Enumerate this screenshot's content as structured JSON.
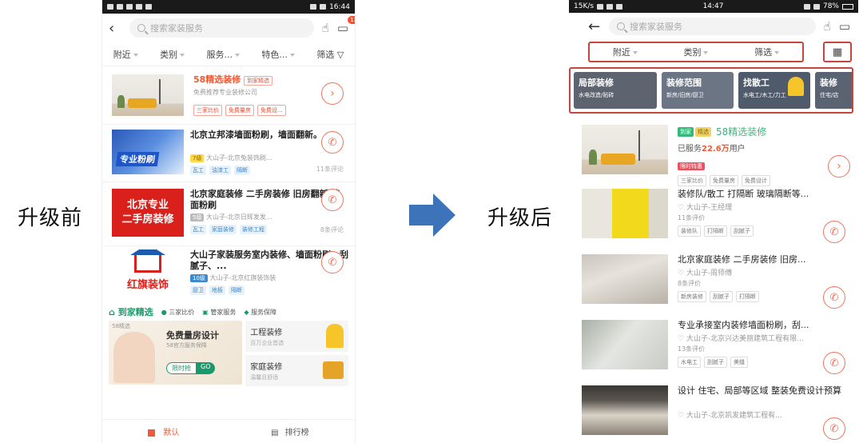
{
  "labels": {
    "before": "升级前",
    "after": "升级后"
  },
  "colors": {
    "accent": "#f0735a",
    "highlight_box": "#c3463f",
    "arrow": "#3c73b9"
  },
  "before": {
    "status": {
      "time": "16:44"
    },
    "search_placeholder": "搜索家装服务",
    "message_badge": "12",
    "filters": [
      "附近",
      "类别",
      "服务...",
      "特色...",
      "筛选"
    ],
    "featured": {
      "title": "58精选装修",
      "badge": "到家精选",
      "subtitle": "免费推荐专业装修公司",
      "tags": [
        "三家比价",
        "免费量房",
        "免费设..."
      ]
    },
    "listings": [
      {
        "title": "北京立邦漆墙面粉刷，墙面翻新。",
        "thumb_text": "专业粉刷",
        "level": "7级",
        "sub": "大山子-北京兔装饰刷...",
        "tags": [
          "瓦工",
          "油漆工",
          "隔断"
        ],
        "reviews": "11条评论"
      },
      {
        "title": "北京家庭装修 二手房装修 旧房翻新 墙面粉刷",
        "thumb_lines": [
          "北京专业",
          "二手房装修"
        ],
        "level": "5级",
        "sub": "大山子-北京日辉发发...",
        "tags": [
          "瓦工",
          "家庭装修",
          "装修工程"
        ],
        "reviews": "8条评论"
      },
      {
        "title": "大山子家装服务室内装修、墙面粉刷，刮腻子、...",
        "thumb_text": "红旗装饰",
        "level": "10级",
        "sub": "大山子-北京红旗装饰装",
        "tags": [
          "厨卫",
          "地板",
          "隔断"
        ],
        "reviews": ""
      }
    ],
    "daojia": {
      "title": "到家精选",
      "features": [
        "三家比价",
        "管家服务",
        "服务保障"
      ]
    },
    "promo": {
      "main_title": "免费量房设计",
      "main_sub": "58官方服务保障",
      "cta": "限时抢",
      "go": "GO",
      "corner": "58精选",
      "right": [
        {
          "title": "工程装修",
          "sub": "百万企业首选"
        },
        {
          "title": "家庭装修",
          "sub": "温馨且舒适"
        }
      ]
    },
    "bottom_tabs": [
      "默认",
      "排行榜"
    ]
  },
  "after": {
    "status": {
      "speed": "15K/s",
      "time": "14:47",
      "battery": "78%"
    },
    "search_placeholder": "搜索家装服务",
    "filters": [
      "附近",
      "类别",
      "筛选"
    ],
    "categories": [
      {
        "title": "局部装修",
        "sub": "水电改造/贴砖",
        "color": "#5d6470"
      },
      {
        "title": "装修范围",
        "sub": "新房/旧房/厨卫",
        "color": "#6c7584"
      },
      {
        "title": "找散工",
        "sub": "水电工/木工/力工",
        "color": "#4f5a6b"
      },
      {
        "title": "装修",
        "sub": "住宅/店",
        "color": "#5a6372"
      }
    ],
    "featured": {
      "badge1": "到家",
      "badge2": "精选",
      "title": "58精选装修",
      "served_prefix": "已服务",
      "served_count": "22.6万",
      "served_suffix": "用户",
      "promo": "限时特惠",
      "tags": [
        "三家比价",
        "免费量房",
        "免费设计"
      ]
    },
    "listings": [
      {
        "title": "装修队/散工 打隔断 玻璃隔断等...",
        "sub": "大山子-王经理",
        "reviews": "11条评价",
        "tags": [
          "装修队",
          "打隔断",
          "刮腻子"
        ]
      },
      {
        "title": "北京家庭装修 二手房装修 旧房...",
        "sub": "大山子-周师傅",
        "reviews": "8条评价",
        "tags": [
          "新房装修",
          "刮腻子",
          "打隔断"
        ]
      },
      {
        "title": "专业承接室内装修墙面粉刷，刮...",
        "sub": "大山子-北京兴达美丽建筑工程有限...",
        "reviews": "13条评价",
        "tags": [
          "水电工",
          "刮腻子",
          "美缝"
        ]
      },
      {
        "title": "设计 住宅、局部等区域 整装免费设计预算",
        "sub": "大山子-北京凯发建筑工程有...",
        "reviews": "",
        "tags": []
      }
    ]
  }
}
